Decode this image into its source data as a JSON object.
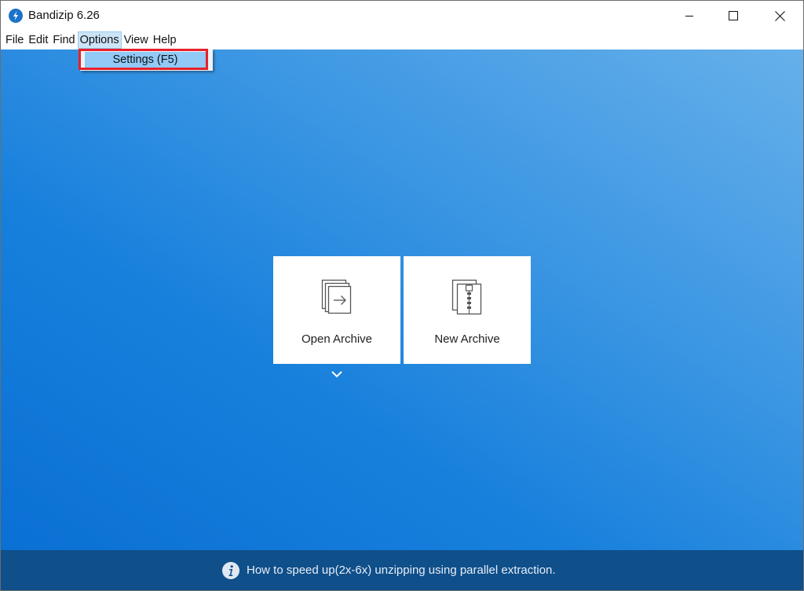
{
  "window": {
    "title": "Bandizip 6.26",
    "controls": [
      "minimize",
      "maximize",
      "close"
    ]
  },
  "menubar": {
    "items": [
      {
        "label": "File"
      },
      {
        "label": "Edit"
      },
      {
        "label": "Find"
      },
      {
        "label": "Options",
        "active": true
      },
      {
        "label": "View"
      },
      {
        "label": "Help"
      }
    ]
  },
  "dropdown": {
    "items": [
      {
        "label": "Settings (F5)",
        "highlighted": true
      }
    ]
  },
  "tiles": {
    "open": {
      "label": "Open Archive",
      "icon": "open-archive-icon"
    },
    "new": {
      "label": "New Archive",
      "icon": "new-archive-icon"
    }
  },
  "infobar": {
    "text": "How to speed up(2x-6x) unzipping using parallel extraction.",
    "icon": "info-icon"
  },
  "colors": {
    "accent": "#1780dc",
    "infobar": "#0f4f8a",
    "highlight": "#e8202a",
    "menu_selected": "#91c9f7"
  }
}
